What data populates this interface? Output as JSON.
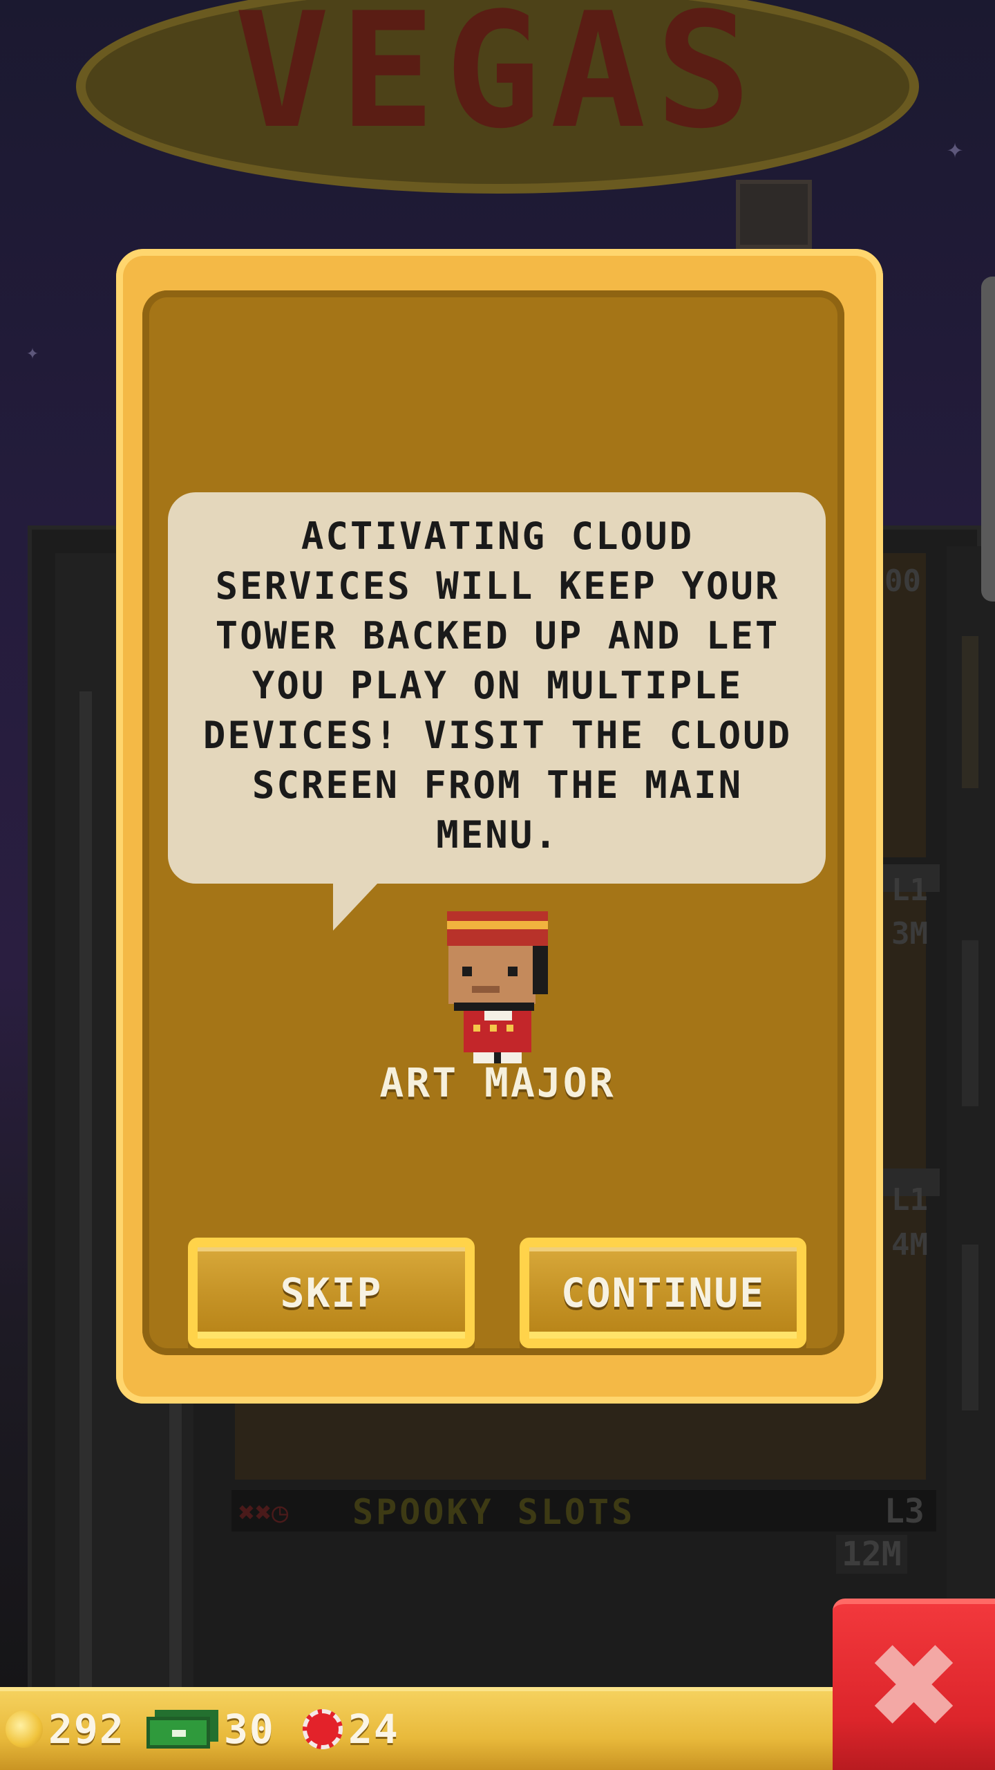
{
  "background": {
    "sign_text": "VEGAS",
    "spooky_floor": {
      "name": "SPOOKY SLOTS",
      "level": "L3",
      "cost": "12M",
      "icons": "✖✖◷"
    },
    "floor_tags": [
      "00",
      "L1",
      "3M",
      "L1",
      "4M"
    ]
  },
  "dialog": {
    "message": "ACTIVATING CLOUD SERVICES WILL KEEP YOUR TOWER BACKED UP AND LET YOU PLAY ON MULTIPLE DEVICES! VISIT THE CLOUD SCREEN FROM THE MAIN MENU.",
    "character_name": "ART MAJOR",
    "skip_label": "SKIP",
    "continue_label": "CONTINUE"
  },
  "resources": {
    "coins": "292",
    "cash": "30",
    "chips": "24"
  },
  "icons": {
    "coin": "coin-icon",
    "cash": "cash-icon",
    "chip": "chip-icon",
    "close": "close-icon"
  },
  "colors": {
    "dialog_frame": "#f4b946",
    "dialog_panel": "#a57517",
    "bubble": "#e4d7bc",
    "close_button": "#dc252b",
    "bottom_bar": "#e8b93b"
  }
}
